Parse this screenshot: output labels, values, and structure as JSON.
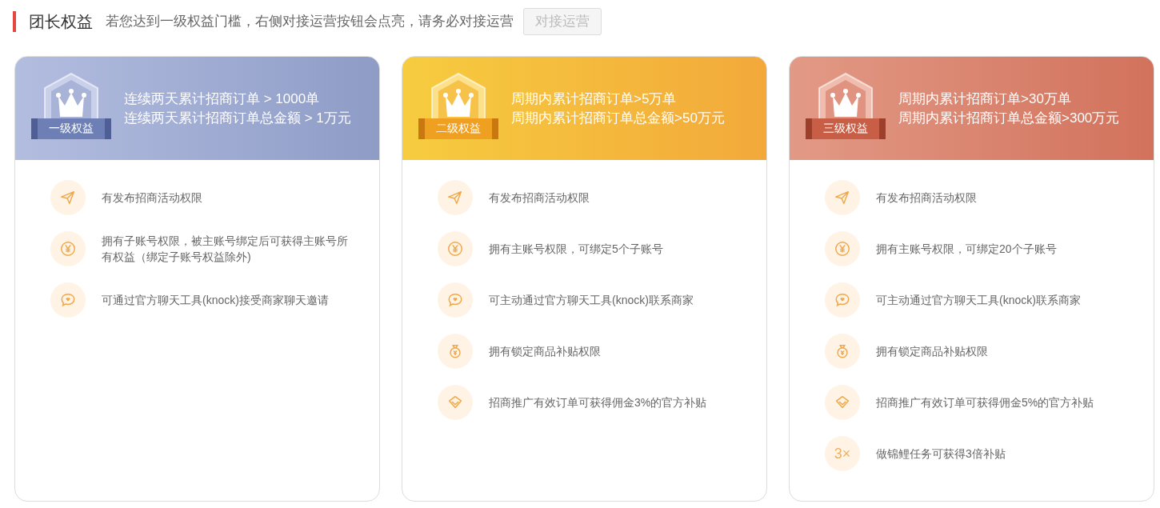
{
  "header": {
    "title": "团长权益",
    "description": "若您达到一级权益门槛，右侧对接运营按钮会点亮，请务必对接运营",
    "button": {
      "label": "对接运营",
      "disabled": true
    }
  },
  "tiers": [
    {
      "kind": "silver",
      "badge": "一级权益",
      "conditions": [
        "连续两天累计招商订单 > 1000单",
        "连续两天累计招商订单总金额 > 1万元"
      ],
      "benefits": [
        {
          "kind": "send",
          "text": "有发布招商活动权限"
        },
        {
          "kind": "yen",
          "text": "拥有子账号权限，被主账号绑定后可获得主账号所有权益（绑定子账号权益除外)"
        },
        {
          "kind": "chat",
          "text": "可通过官方聊天工具(knock)接受商家聊天邀请"
        }
      ]
    },
    {
      "kind": "gold",
      "badge": "二级权益",
      "conditions": [
        "周期内累计招商订单>5万单",
        "周期内累计招商订单总金额>50万元"
      ],
      "benefits": [
        {
          "kind": "send",
          "text": "有发布招商活动权限"
        },
        {
          "kind": "yen",
          "text": "拥有主账号权限，可绑定5个子账号"
        },
        {
          "kind": "chat",
          "text": "可主动通过官方聊天工具(knock)联系商家"
        },
        {
          "kind": "bag",
          "text": "拥有锁定商品补贴权限"
        },
        {
          "kind": "diamond",
          "text": "招商推广有效订单可获得佣金3%的官方补贴"
        }
      ]
    },
    {
      "kind": "copper",
      "badge": "三级权益",
      "conditions": [
        "周期内累计招商订单>30万单",
        "周期内累计招商订单总金额>300万元"
      ],
      "benefits": [
        {
          "kind": "send",
          "text": "有发布招商活动权限"
        },
        {
          "kind": "yen",
          "text": "拥有主账号权限，可绑定20个子账号"
        },
        {
          "kind": "chat",
          "text": "可主动通过官方聊天工具(knock)联系商家"
        },
        {
          "kind": "bag",
          "text": "拥有锁定商品补贴权限"
        },
        {
          "kind": "diamond",
          "text": "招商推广有效订单可获得佣金5%的官方补贴"
        },
        {
          "kind": "text",
          "badge": "3×",
          "text": "做锦鲤任务可获得3倍补贴"
        }
      ]
    }
  ]
}
